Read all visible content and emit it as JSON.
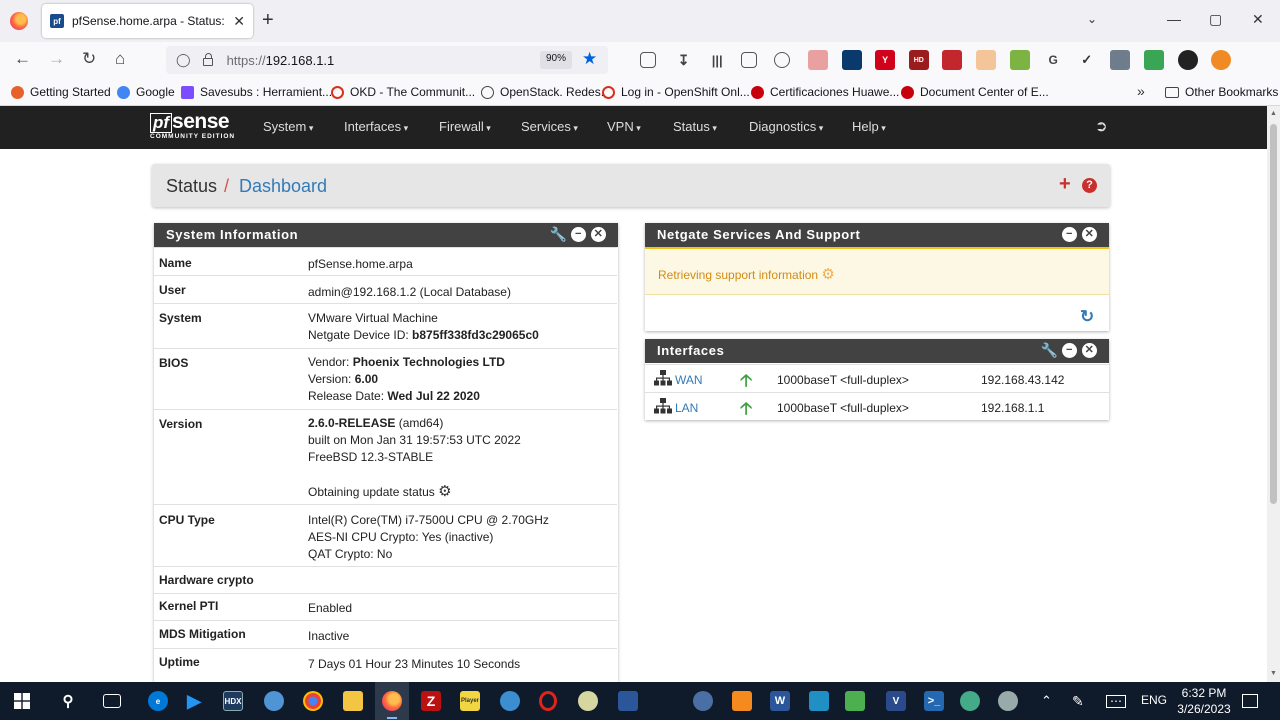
{
  "browser": {
    "tab_title": "pfSense.home.arpa - Status: Dashboard",
    "tab_favicon": "pf",
    "url_protocol": "https://",
    "url_host": "192.168.1.1",
    "zoom": "90%",
    "win_min": "—",
    "win_max": "▢",
    "win_close": "✕",
    "bookmarks": [
      {
        "label": "Getting Started",
        "color": "#e8612c"
      },
      {
        "label": "Google",
        "color": "#4285f4"
      },
      {
        "label": "Savesubs : Herramient...",
        "color": "#7c4dff"
      },
      {
        "label": "OKD - The Communit...",
        "color": "#d9301c"
      },
      {
        "label": "OpenStack. Redes.",
        "color": "#444444"
      },
      {
        "label": "Log in - OpenShift Onl...",
        "color": "#d9301c"
      },
      {
        "label": "Certificaciones Huawe...",
        "color": "#c7000b"
      },
      {
        "label": "Document Center of E...",
        "color": "#c7000b"
      }
    ],
    "bookmarks_more": "»",
    "other_bookmarks": "Other Bookmarks"
  },
  "pfsense": {
    "logo_pf": "pf",
    "logo_sense": "sense",
    "logo_edition": "COMMUNITY EDITION",
    "menu": [
      "System",
      "Interfaces",
      "Firewall",
      "Services",
      "VPN",
      "Status",
      "Diagnostics",
      "Help"
    ],
    "breadcrumb_status": "Status",
    "breadcrumb_sep": "/",
    "breadcrumb_page": "Dashboard",
    "breadcrumb_add": "+",
    "breadcrumb_help": "?"
  },
  "system_info": {
    "title": "System Information",
    "rows": [
      {
        "label": "Name",
        "lines": [
          "pfSense.home.arpa"
        ]
      },
      {
        "label": "User",
        "lines": [
          "admin@192.168.1.2 (Local Database)"
        ]
      },
      {
        "label": "System",
        "line1": "VMware Virtual Machine",
        "line2_prefix": "Netgate Device ID: ",
        "line2_bold": "b875ff338fd3c29065c0"
      },
      {
        "label": "BIOS",
        "vendor_prefix": "Vendor: ",
        "vendor": "Phoenix Technologies LTD",
        "version_prefix": "Version: ",
        "version": "6.00",
        "release_prefix": "Release Date: ",
        "release": "Wed Jul 22 2020"
      },
      {
        "label": "Version",
        "ver_bold": "2.6.0-RELEASE",
        "ver_arch": " (amd64)",
        "built": "built on Mon Jan 31 19:57:53 UTC 2022",
        "os": "FreeBSD 12.3-STABLE",
        "update": "Obtaining update status"
      },
      {
        "label": "CPU Type",
        "lines": [
          "Intel(R) Core(TM) i7-7500U CPU @ 2.70GHz",
          "AES-NI CPU Crypto: Yes (inactive)",
          "QAT Crypto: No"
        ]
      },
      {
        "label": "Hardware crypto",
        "lines": []
      },
      {
        "label": "Kernel PTI",
        "lines": [
          "Enabled"
        ]
      },
      {
        "label": "MDS Mitigation",
        "lines": [
          "Inactive"
        ]
      },
      {
        "label": "Uptime",
        "lines": [
          "7 Days 01 Hour 23 Minutes 10 Seconds"
        ]
      }
    ]
  },
  "support": {
    "title": "Netgate Services And Support",
    "message": "Retrieving support information"
  },
  "interfaces": {
    "title": "Interfaces",
    "rows": [
      {
        "name": "WAN",
        "status": "up",
        "speed": "1000baseT <full-duplex>",
        "ip": "192.168.43.142"
      },
      {
        "name": "LAN",
        "status": "up",
        "speed": "1000baseT <full-duplex>",
        "ip": "192.168.1.1"
      }
    ]
  },
  "taskbar": {
    "language": "ENG",
    "time": "6:32 PM",
    "date": "3/26/2023"
  }
}
